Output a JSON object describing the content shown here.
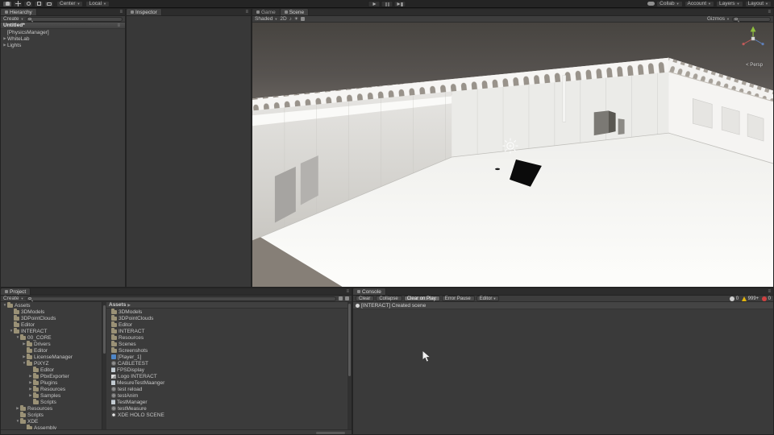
{
  "glyphs": {
    "dd": "▼",
    "menu": "≡",
    "chevron": "▶"
  },
  "icons": {
    "audio": "♪",
    "effects": "☀"
  },
  "topbar": {
    "pivot": "Center",
    "space": "Local",
    "collab": "Collab",
    "account": "Account",
    "layers": "Layers",
    "layout": "Layout"
  },
  "hierarchy": {
    "tab": "Hierarchy",
    "create": "Create",
    "scene_header": "Untitled*",
    "items": [
      {
        "label": "[PhysicsManager]",
        "arrow": "",
        "depth": 0
      },
      {
        "label": "WhiteLab",
        "arrow": "▶",
        "depth": 0
      },
      {
        "label": "Lights",
        "arrow": "▶",
        "depth": 0
      }
    ]
  },
  "inspector": {
    "tab": "Inspector"
  },
  "scene": {
    "game_tab": "Game",
    "scene_tab": "Scene",
    "shaded": "Shaded",
    "mode2d": "2D",
    "gizmos": "Gizmos",
    "persp_label": "< Persp"
  },
  "project": {
    "tab": "Project",
    "create": "Create",
    "breadcrumb": "Assets",
    "tree": [
      {
        "label": "Assets",
        "depth": 0,
        "arrow": "▼",
        "icon": "folder"
      },
      {
        "label": "3DModels",
        "depth": 1,
        "arrow": "",
        "icon": "folder"
      },
      {
        "label": "3DPointClouds",
        "depth": 1,
        "arrow": "",
        "icon": "folder"
      },
      {
        "label": "Editor",
        "depth": 1,
        "arrow": "",
        "icon": "folder"
      },
      {
        "label": "INTERACT",
        "depth": 1,
        "arrow": "▼",
        "icon": "folder"
      },
      {
        "label": "00_CORE",
        "depth": 2,
        "arrow": "▼",
        "icon": "folder"
      },
      {
        "label": "Drivers",
        "depth": 3,
        "arrow": "▶",
        "icon": "folder"
      },
      {
        "label": "Editor",
        "depth": 3,
        "arrow": "",
        "icon": "folder"
      },
      {
        "label": "LicenseManager",
        "depth": 3,
        "arrow": "▶",
        "icon": "folder"
      },
      {
        "label": "PiXYZ",
        "depth": 3,
        "arrow": "▼",
        "icon": "folder"
      },
      {
        "label": "Editor",
        "depth": 4,
        "arrow": "",
        "icon": "folder"
      },
      {
        "label": "PbxExporter",
        "depth": 4,
        "arrow": "▶",
        "icon": "folder"
      },
      {
        "label": "Plugins",
        "depth": 4,
        "arrow": "▶",
        "icon": "folder"
      },
      {
        "label": "Resources",
        "depth": 4,
        "arrow": "▶",
        "icon": "folder"
      },
      {
        "label": "Samples",
        "depth": 4,
        "arrow": "▶",
        "icon": "folder"
      },
      {
        "label": "Scripts",
        "depth": 4,
        "arrow": "",
        "icon": "folder"
      },
      {
        "label": "Resources",
        "depth": 2,
        "arrow": "▶",
        "icon": "folder"
      },
      {
        "label": "Scripts",
        "depth": 2,
        "arrow": "",
        "icon": "folder"
      },
      {
        "label": "XDE",
        "depth": 2,
        "arrow": "▼",
        "icon": "folder"
      },
      {
        "label": "Assembly",
        "depth": 3,
        "arrow": "",
        "icon": "folder"
      }
    ],
    "assets": [
      {
        "label": "3DModels",
        "icon": "folder"
      },
      {
        "label": "3DPointClouds",
        "icon": "folder"
      },
      {
        "label": "Editor",
        "icon": "folder"
      },
      {
        "label": "INTERACT",
        "icon": "folder"
      },
      {
        "label": "Resources",
        "icon": "folder"
      },
      {
        "label": "Scenes",
        "icon": "folder"
      },
      {
        "label": "Screenshots",
        "icon": "folder"
      },
      {
        "label": "[Player_1]",
        "icon": "prefab"
      },
      {
        "label": "CABLETEST",
        "icon": "asset"
      },
      {
        "label": "FPSDisplay",
        "icon": "script"
      },
      {
        "label": "Logo INTERACT",
        "icon": "texture"
      },
      {
        "label": "MesureTestMaanger",
        "icon": "script"
      },
      {
        "label": "test reload",
        "icon": "asset"
      },
      {
        "label": "testAnim",
        "icon": "asset"
      },
      {
        "label": "TestManager",
        "icon": "script"
      },
      {
        "label": "testMeasure",
        "icon": "asset"
      },
      {
        "label": "XDE HOLO SCENE",
        "icon": "scene"
      }
    ]
  },
  "console": {
    "tab": "Console",
    "buttons": [
      {
        "label": "Clear",
        "active": false,
        "arrow": ""
      },
      {
        "label": "Collapse",
        "active": false,
        "arrow": ""
      },
      {
        "label": "Clear on Play",
        "active": true,
        "arrow": ""
      },
      {
        "label": "Error Pause",
        "active": false,
        "arrow": ""
      },
      {
        "label": "Editor",
        "active": false,
        "arrow": "▼"
      }
    ],
    "counts": {
      "info": "0",
      "warning": "999+",
      "error": "0"
    },
    "log_entry": "[INTERACT] Created scene"
  }
}
